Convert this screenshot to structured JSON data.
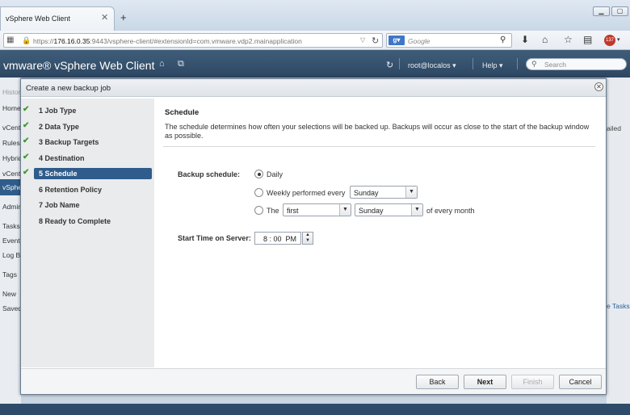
{
  "browser": {
    "tab_title": "vSphere Web Client",
    "tab_close": "✕",
    "new_tab": "+",
    "url_host": "176.16.0.35",
    "url_pre": "https://",
    "url_post": ":9443/vsphere-client/#extensionId=com.vmware.vdp2.mainapplication",
    "search_engine_label": "Google",
    "badge_count": "137"
  },
  "app": {
    "title": "vmware® vSphere Web Client",
    "user": "root@localos ▾",
    "help": "Help ▾",
    "search_placeholder": "Search"
  },
  "bg_nav": {
    "history": "History",
    "items": [
      "Home",
      "vCenter",
      "Rules",
      "Hybrid",
      "vCenter",
      "vSphere",
      "Admin",
      "Tasks",
      "Events",
      "Log B",
      "Tags",
      "New",
      "Saved"
    ],
    "right_text_1": "ailed",
    "right_text_2": "e Tasks"
  },
  "modal": {
    "title": "Create a new backup job",
    "close": "✕"
  },
  "steps": [
    {
      "label": "1  Job Type",
      "done": true
    },
    {
      "label": "2  Data Type",
      "done": true
    },
    {
      "label": "3  Backup Targets",
      "done": true
    },
    {
      "label": "4  Destination",
      "done": true
    },
    {
      "label": "5  Schedule",
      "done": true,
      "active": true
    },
    {
      "label": "6  Retention Policy",
      "done": false
    },
    {
      "label": "7  Job Name",
      "done": false
    },
    {
      "label": "8  Ready to Complete",
      "done": false
    }
  ],
  "schedule": {
    "title": "Schedule",
    "description": "The schedule determines how often your selections will be backed up.  Backups will occur as close to the start of the backup window as possible.",
    "backup_schedule_label": "Backup schedule:",
    "option_daily": "Daily",
    "option_weekly": "Weekly performed every",
    "weekly_day": "Sunday",
    "option_the": "The",
    "the_ordinal": "first",
    "the_day": "Sunday",
    "of_every_month": "of every month",
    "selected_option": "daily",
    "start_time_label": "Start Time on Server:",
    "start_time": "8 : 00  PM"
  },
  "footer": {
    "back": "Back",
    "next": "Next",
    "finish": "Finish",
    "cancel": "Cancel"
  }
}
